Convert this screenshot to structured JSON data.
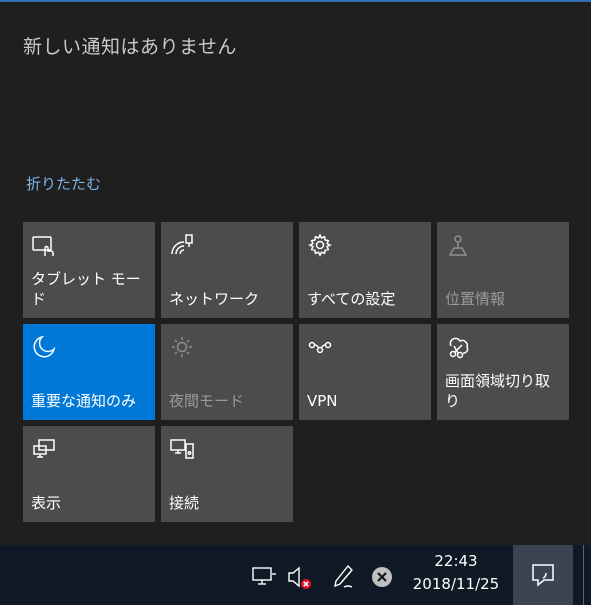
{
  "action_center": {
    "no_notifications_text": "新しい通知はありません",
    "collapse_label": "折りたたむ",
    "tiles": [
      {
        "label": "タブレット モード",
        "icon": "tablet-mode-icon",
        "state": "normal"
      },
      {
        "label": "ネットワーク",
        "icon": "network-icon",
        "state": "normal"
      },
      {
        "label": "すべての設定",
        "icon": "settings-gear-icon",
        "state": "normal"
      },
      {
        "label": "位置情報",
        "icon": "location-icon",
        "state": "disabled"
      },
      {
        "label": "重要な通知のみ",
        "icon": "moon-icon",
        "state": "active"
      },
      {
        "label": "夜間モード",
        "icon": "brightness-icon",
        "state": "disabled"
      },
      {
        "label": "VPN",
        "icon": "vpn-icon",
        "state": "normal"
      },
      {
        "label": "画面領域切り取り",
        "icon": "snip-icon",
        "state": "normal"
      },
      {
        "label": "表示",
        "icon": "project-display-icon",
        "state": "normal"
      },
      {
        "label": "接続",
        "icon": "connect-icon",
        "state": "normal"
      }
    ]
  },
  "taskbar": {
    "time": "22:43",
    "date": "2018/11/25",
    "icons": [
      "network-wired-icon",
      "volume-muted-icon",
      "pen-icon",
      "close-circle-icon"
    ]
  },
  "colors": {
    "background": "#1f1f1f",
    "tile": "#4c4c4c",
    "tile_active": "#0078d7",
    "link": "#7fb2e5",
    "taskbar": "#101a26"
  }
}
